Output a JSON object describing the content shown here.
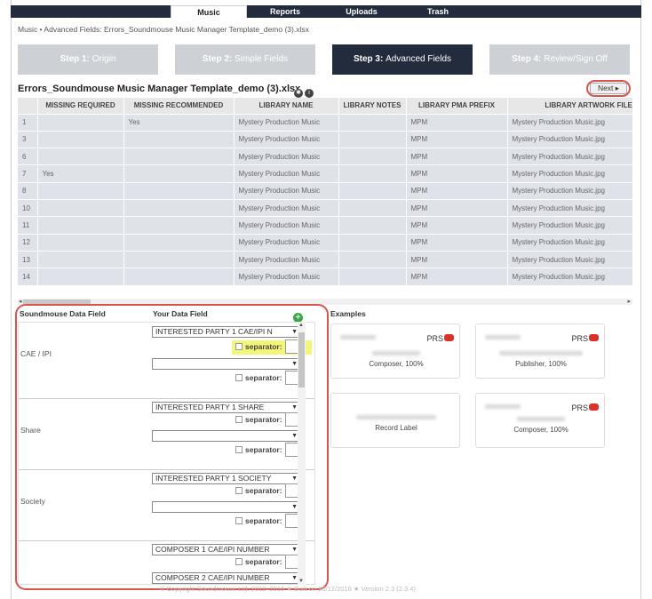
{
  "nav": {
    "tabs": [
      "Music",
      "Reports",
      "Uploads",
      "Trash"
    ]
  },
  "breadcrumb": "Music • Advanced Fields: Errors_Soundmouse Music Manager Template_demo (3).xlsx",
  "steps": [
    {
      "num": "Step 1:",
      "label": "Origin"
    },
    {
      "num": "Step 2:",
      "label": "Simple Fields"
    },
    {
      "num": "Step 3:",
      "label": "Advanced Fields"
    },
    {
      "num": "Step 4:",
      "label": "Review/Sign Off"
    }
  ],
  "file_title": "Errors_Soundmouse Music Manager Template_demo (3).xlsx",
  "next_label": "Next ▸",
  "grid": {
    "columns": [
      "",
      "MISSING REQUIRED",
      "MISSING RECOMMENDED",
      "LIBRARY NAME",
      "LIBRARY NOTES",
      "LIBRARY PMA PREFIX",
      "LIBRARY ARTWORK FILE NAME"
    ],
    "rows": [
      [
        "1",
        "",
        "Yes",
        "Mystery Production Music",
        "",
        "MPM",
        "Mystery Production Music.jpg"
      ],
      [
        "3",
        "",
        "",
        "Mystery Production Music",
        "",
        "MPM",
        "Mystery Production Music.jpg"
      ],
      [
        "6",
        "",
        "",
        "Mystery Production Music",
        "",
        "MPM",
        "Mystery Production Music.jpg"
      ],
      [
        "7",
        "Yes",
        "",
        "Mystery Production Music",
        "",
        "MPM",
        "Mystery Production Music.jpg"
      ],
      [
        "8",
        "",
        "",
        "Mystery Production Music",
        "",
        "MPM",
        "Mystery Production Music.jpg"
      ],
      [
        "10",
        "",
        "",
        "Mystery Production Music",
        "",
        "MPM",
        "Mystery Production Music.jpg"
      ],
      [
        "11",
        "",
        "",
        "Mystery Production Music",
        "",
        "MPM",
        "Mystery Production Music.jpg"
      ],
      [
        "12",
        "",
        "",
        "Mystery Production Music",
        "",
        "MPM",
        "Mystery Production Music.jpg"
      ],
      [
        "13",
        "",
        "",
        "Mystery Production Music",
        "",
        "MPM",
        "Mystery Production Music.jpg"
      ],
      [
        "14",
        "",
        "",
        "Mystery Production Music",
        "",
        "MPM",
        "Mystery Production Music.jpg"
      ]
    ]
  },
  "mapping": {
    "hdr_field": "Soundmouse Data Field",
    "hdr_yours": "Your Data Field",
    "hdr_examples": "Examples",
    "separator_label": "separator:",
    "groups": [
      {
        "name": "CAE / IPI",
        "select1": "INTERESTED PARTY 1 CAE/IPI N",
        "select2": ""
      },
      {
        "name": "Share",
        "select1": "INTERESTED PARTY 1 SHARE",
        "select2": ""
      },
      {
        "name": "Society",
        "select1": "INTERESTED PARTY 1 SOCIETY",
        "select2": ""
      },
      {
        "name": "",
        "select1": "COMPOSER 1 CAE/IPI NUMBER",
        "select2": "COMPOSER 2 CAE/IPI NUMBER"
      }
    ]
  },
  "examples": [
    {
      "prs": "PRS",
      "role": "Composer, 100%"
    },
    {
      "prs": "PRS",
      "role": "Publisher, 100%"
    },
    {
      "prs": "",
      "role": "Record Label"
    },
    {
      "prs": "PRS",
      "role": "Composer, 100%"
    }
  ],
  "footer": "© Copyright Soundmouse Ltd. 2012–2016 ★ Built on 20/12/2016 ★ Version 2.3 (2.3.4)",
  "colors": {
    "nav": "#222c3c",
    "highlight": "#d9534f",
    "prs_badge": "#d9322a",
    "add": "#3aa845"
  }
}
